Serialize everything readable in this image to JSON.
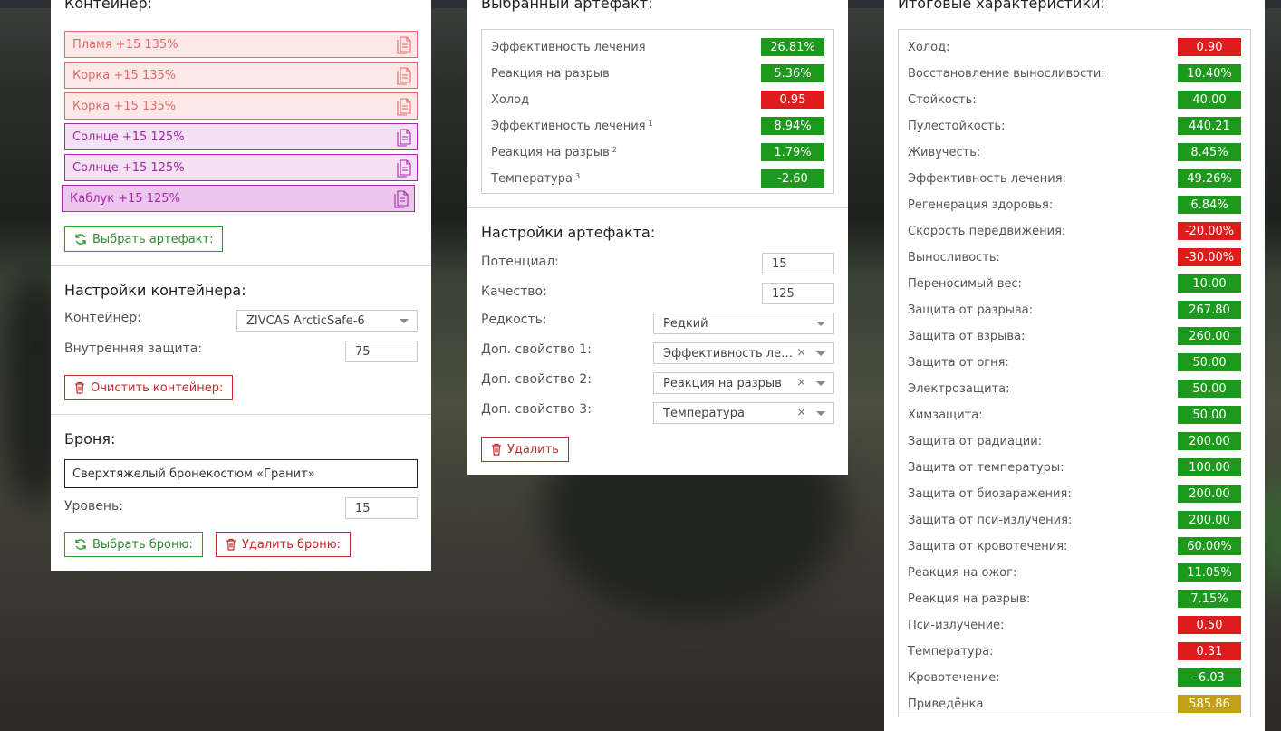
{
  "colors": {
    "green": "#1d9a1d",
    "red": "#e01b1b",
    "yellow": "#c2a017"
  },
  "container_panel": {
    "title": "Контейнер:",
    "artifacts": [
      {
        "label": "Пламя +15 135%",
        "color": "red"
      },
      {
        "label": "Корка +15 135%",
        "color": "red"
      },
      {
        "label": "Корка +15 135%",
        "color": "red"
      },
      {
        "label": "Солнце +15 125%",
        "color": "purple"
      },
      {
        "label": "Солнце +15 125%",
        "color": "purple"
      },
      {
        "label": "Каблук +15 125%",
        "color": "purple"
      }
    ],
    "select_artifact_button": "Выбрать артефакт:",
    "settings_title": "Настройки контейнера:",
    "container_label": "Контейнер:",
    "container_value": "ZIVCAS ArcticSafe-6",
    "inner_protection_label": "Внутренняя защита:",
    "inner_protection_value": "75",
    "clear_button": "Очистить контейнер:",
    "armor_title": "Броня:",
    "armor_value": "Сверхтяжелый бронекостюм «Гранит»",
    "level_label": "Уровень:",
    "level_value": "15",
    "select_armor_button": "Выбрать броню:",
    "delete_armor_button": "Удалить броню:"
  },
  "artifact_panel": {
    "title": "Выбранный артефакт:",
    "stats": [
      {
        "name": "Эффективность лечения",
        "sup": "",
        "value": "26.81%",
        "color": "g"
      },
      {
        "name": "Реакция на разрыв",
        "sup": "",
        "value": "5.36%",
        "color": "g"
      },
      {
        "name": "Холод",
        "sup": "",
        "value": "0.95",
        "color": "r"
      },
      {
        "name": "Эффективность лечения",
        "sup": "1",
        "value": "8.94%",
        "color": "g"
      },
      {
        "name": "Реакция на разрыв",
        "sup": "2",
        "value": "1.79%",
        "color": "g"
      },
      {
        "name": "Температура",
        "sup": "3",
        "value": "-2.60",
        "color": "g"
      }
    ],
    "settings_title": "Настройки артефакта:",
    "potential_label": "Потенциал:",
    "potential_value": "15",
    "quality_label": "Качество:",
    "quality_value": "125",
    "rarity_label": "Редкость:",
    "rarity_value": "Редкий",
    "extra1_label": "Доп. свойство 1:",
    "extra1_value": "Эффективность лечения",
    "extra2_label": "Доп. свойство 2:",
    "extra2_value": "Реакция на разрыв",
    "extra3_label": "Доп. свойство 3:",
    "extra3_value": "Температура",
    "delete_button": "Удалить"
  },
  "totals_panel": {
    "title": "Итоговые характеристики:",
    "stats": [
      {
        "name": "Холод:",
        "value": "0.90",
        "color": "r"
      },
      {
        "name": "Восстановление выносливости:",
        "value": "10.40%",
        "color": "g"
      },
      {
        "name": "Стойкость:",
        "value": "40.00",
        "color": "g"
      },
      {
        "name": "Пулестойкость:",
        "value": "440.21",
        "color": "g"
      },
      {
        "name": "Живучесть:",
        "value": "8.45%",
        "color": "g"
      },
      {
        "name": "Эффективность лечения:",
        "value": "49.26%",
        "color": "g"
      },
      {
        "name": "Регенерация здоровья:",
        "value": "6.84%",
        "color": "g"
      },
      {
        "name": "Скорость передвижения:",
        "value": "-20.00%",
        "color": "r"
      },
      {
        "name": "Выносливость:",
        "value": "-30.00%",
        "color": "r"
      },
      {
        "name": "Переносимый вес:",
        "value": "10.00",
        "color": "g"
      },
      {
        "name": "Защита от разрыва:",
        "value": "267.80",
        "color": "g"
      },
      {
        "name": "Защита от взрыва:",
        "value": "260.00",
        "color": "g"
      },
      {
        "name": "Защита от огня:",
        "value": "50.00",
        "color": "g"
      },
      {
        "name": "Электрозащита:",
        "value": "50.00",
        "color": "g"
      },
      {
        "name": "Химзащита:",
        "value": "50.00",
        "color": "g"
      },
      {
        "name": "Защита от радиации:",
        "value": "200.00",
        "color": "g"
      },
      {
        "name": "Защита от температуры:",
        "value": "100.00",
        "color": "g"
      },
      {
        "name": "Защита от биозаражения:",
        "value": "200.00",
        "color": "g"
      },
      {
        "name": "Защита от пси-излучения:",
        "value": "200.00",
        "color": "g"
      },
      {
        "name": "Защита от кровотечения:",
        "value": "60.00%",
        "color": "g"
      },
      {
        "name": "Реакция на ожог:",
        "value": "11.05%",
        "color": "g"
      },
      {
        "name": "Реакция на разрыв:",
        "value": "7.15%",
        "color": "g"
      },
      {
        "name": "Пси-излучение:",
        "value": "0.50",
        "color": "r"
      },
      {
        "name": "Температура:",
        "value": "0.31",
        "color": "r"
      },
      {
        "name": "Кровотечение:",
        "value": "-6.03",
        "color": "g"
      },
      {
        "name": "Приведёнка",
        "value": "585.86",
        "color": "y"
      }
    ]
  }
}
